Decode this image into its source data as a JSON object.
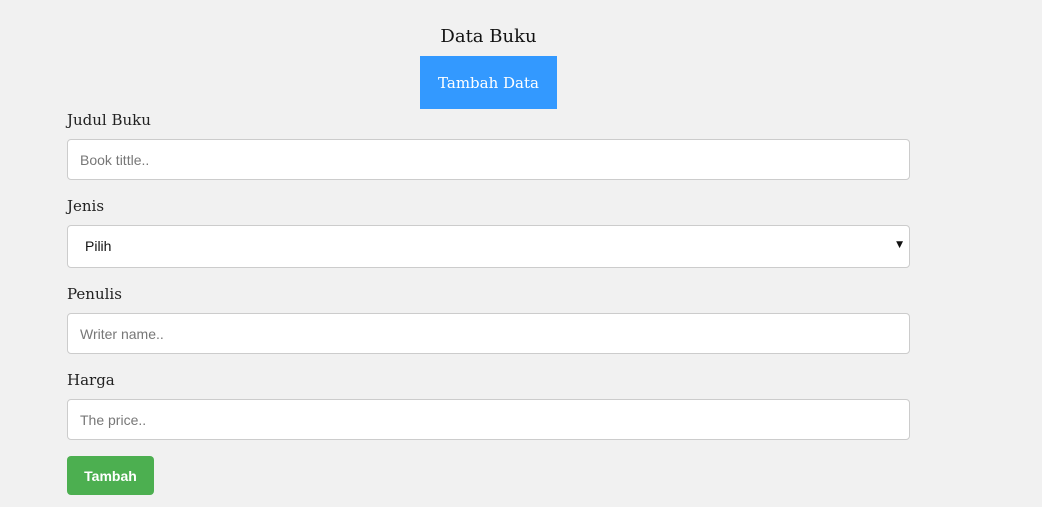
{
  "header": {
    "title": "Data Buku",
    "add_tab_label": "Tambah Data"
  },
  "form": {
    "title_field": {
      "label": "Judul Buku",
      "placeholder": "Book tittle..",
      "value": ""
    },
    "genre_field": {
      "label": "Jenis",
      "selected": "Pilih"
    },
    "writer_field": {
      "label": "Penulis",
      "placeholder": "Writer name..",
      "value": ""
    },
    "price_field": {
      "label": "Harga",
      "placeholder": "The price..",
      "value": ""
    },
    "submit_label": "Tambah"
  },
  "colors": {
    "background": "#f1f1f1",
    "tab_accent": "#3399ff",
    "submit_accent": "#4caf50"
  },
  "icons": {
    "select_arrow": "dropdown-arrow-icon"
  }
}
